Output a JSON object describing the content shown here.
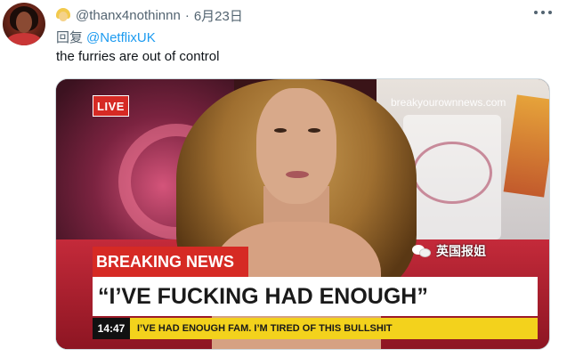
{
  "tweet": {
    "handle": "@thanx4nothinnn",
    "separator": "·",
    "date": "6月23日",
    "reply_prefix": "回复",
    "reply_to": "@NetflixUK",
    "text": "the furries are out of control"
  },
  "media": {
    "live_label": "LIVE",
    "watermark": "breakyourownnews.com",
    "breaking_label": "BREAKING NEWS",
    "headline": "“I’VE FUCKING HAD ENOUGH”",
    "ticker_time": "14:47",
    "ticker_text": "I’VE HAD ENOUGH FAM. I’M TIRED OF THIS BULLSHIT"
  },
  "wechat_watermark": "英国报姐",
  "colors": {
    "link": "#1d9bf0",
    "muted": "#536471",
    "breaking_red": "#d62a24",
    "ticker_yellow": "#f3d21c"
  },
  "icons": [
    "avatar",
    "person-emoji-icon",
    "more-options-icon",
    "wechat-icon"
  ]
}
